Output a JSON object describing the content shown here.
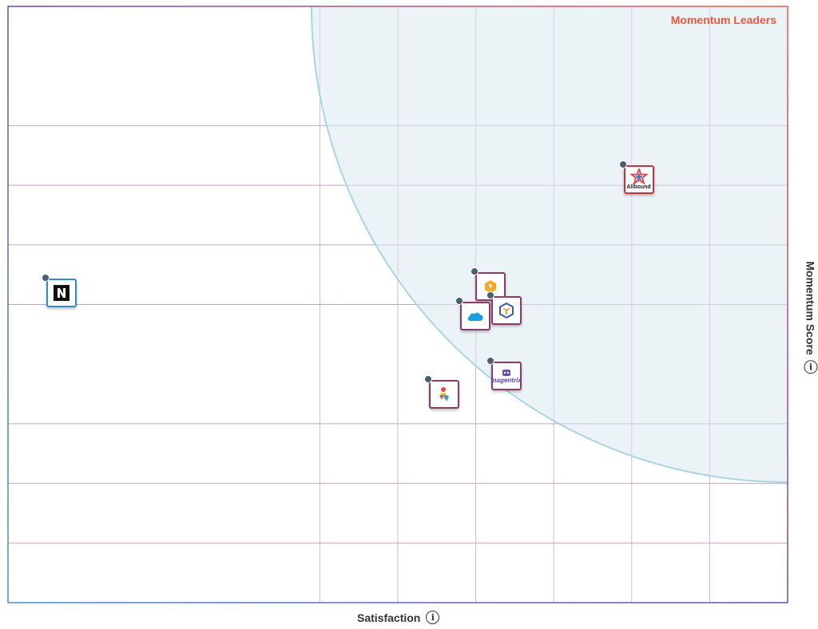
{
  "chart_data": {
    "type": "scatter",
    "title": "",
    "xlabel": "Satisfaction",
    "ylabel": "Momentum Score",
    "quadrant_label": "Momentum Leaders",
    "grid": true,
    "xlim": [
      0,
      100
    ],
    "ylim": [
      0,
      100
    ],
    "points": [
      {
        "icon": "n-square-logo",
        "x": 7,
        "y": 52,
        "border": "#2f8fc9"
      },
      {
        "icon": "allbound-logo",
        "text": "Allbound",
        "x": 81,
        "y": 71,
        "border": "#c2343f"
      },
      {
        "icon": "orange-hexagon-logo",
        "x": 62,
        "y": 53,
        "border": "#8a3b6b"
      },
      {
        "icon": "cube-logo",
        "x": 64,
        "y": 49,
        "border": "#8a3b6b"
      },
      {
        "icon": "salesforce-cloud-logo",
        "x": 60,
        "y": 48,
        "border": "#8a3b6b"
      },
      {
        "icon": "magentrix-logo",
        "text": "magentrix",
        "x": 64,
        "y": 38,
        "border": "#8a3b6b"
      },
      {
        "icon": "colorful-figure-logo",
        "x": 56,
        "y": 35,
        "border": "#8a3b6b"
      }
    ]
  }
}
